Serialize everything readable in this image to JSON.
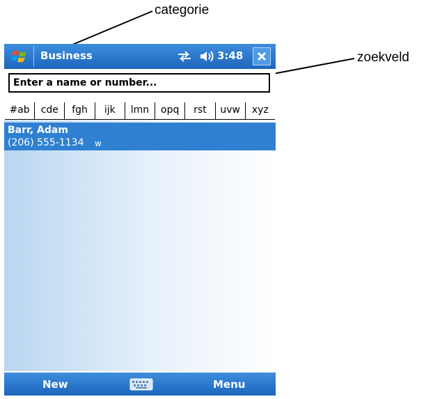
{
  "callouts": {
    "category": "categorie",
    "search": "zoekveld"
  },
  "titlebar": {
    "title": "Business",
    "clock": "3:48",
    "icons": [
      "windows-start-icon",
      "sync-icon",
      "speaker-icon",
      "close-icon"
    ]
  },
  "search": {
    "placeholder": "Enter a name or number..."
  },
  "abc_tabs": [
    "#ab",
    "cde",
    "fgh",
    "ijk",
    "lmn",
    "opq",
    "rst",
    "uvw",
    "xyz"
  ],
  "contacts": [
    {
      "name": "Barr, Adam",
      "phone": "(206) 555-1134",
      "type": "w"
    }
  ],
  "menubar": {
    "left": "New",
    "right": "Menu"
  },
  "colors": {
    "bar_blue": "#2a77cc",
    "selection_blue": "#2f80d1"
  }
}
